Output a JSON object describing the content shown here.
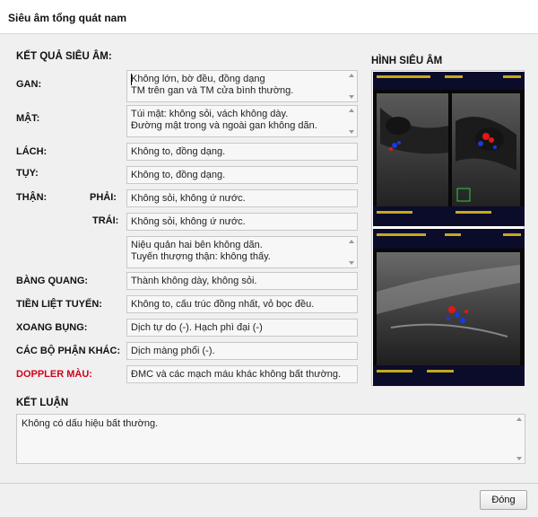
{
  "window": {
    "title": "Siêu âm tổng quát nam"
  },
  "results": {
    "heading": "KẾT QUẢ SIÊU ÂM:",
    "gan": {
      "label": "GAN:",
      "lines": [
        "Không lớn, bờ đều, đồng dạng",
        "TM trên gan và TM cửa bình thường."
      ]
    },
    "mat": {
      "label": "MẬT:",
      "lines": [
        "Túi mật: không sỏi, vách không dày.",
        "Đường mật trong và ngoài gan không dãn."
      ]
    },
    "lach": {
      "label": "LÁCH:",
      "value": "Không to, đồng dạng."
    },
    "tuy": {
      "label": "TỤY:",
      "value": "Không to, đồng dạng."
    },
    "than": {
      "label": "THẬN:",
      "phai_label": "PHẢI:",
      "phai_value": "Không sỏi, không ứ nước.",
      "trai_label": "TRÁI:",
      "trai_value": "Không sỏi, không ứ nước.",
      "extra_lines": [
        "Niệu quản hai bên không dãn.",
        "Tuyến thượng thận: không thấy."
      ]
    },
    "bang_quang": {
      "label": "BÀNG QUANG:",
      "value": "Thành không dày, không sỏi."
    },
    "tien_liet_tuyen": {
      "label": "TIỀN LIỆT TUYẾN:",
      "value": "Không to, cấu trúc đồng nhất, vỏ bọc đều."
    },
    "xoang_bung": {
      "label": "XOANG BỤNG:",
      "value": "Dịch tự do (-). Hạch phì đại (-)"
    },
    "cac_bo_phan_khac": {
      "label": "CÁC BỘ PHẬN KHÁC:",
      "value": "Dịch màng phổi (-)."
    },
    "doppler": {
      "label": "DOPPLER MÀU:",
      "value": "ĐMC và các mạch máu khác không bất thường.",
      "color": "#d0021b"
    }
  },
  "images": {
    "heading": "HÌNH SIÊU ÂM",
    "colors": {
      "flow_red": "#e01818",
      "flow_blue": "#1838e0",
      "overlay_text": "#f2d21a",
      "background": "#080808"
    }
  },
  "conclusion": {
    "heading": "KẾT LUẬN",
    "value": "Không có dấu hiệu bất thường."
  },
  "footer": {
    "close_label": "Đóng"
  },
  "icons": {
    "scroll_up": "scroll-up-arrow-icon",
    "scroll_down": "scroll-down-arrow-icon"
  }
}
